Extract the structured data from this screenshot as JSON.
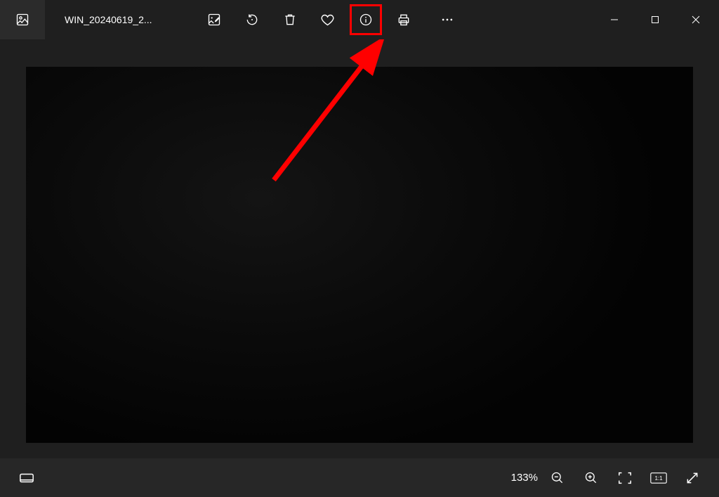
{
  "title": "WIN_20240619_2...",
  "toolbar": {
    "edit": "edit-image",
    "rotate": "rotate",
    "delete": "delete",
    "favorite": "favorite",
    "info": "file-info",
    "print": "print",
    "more": "more"
  },
  "window": {
    "minimize": "minimize",
    "maximize": "maximize",
    "close": "close"
  },
  "bottom": {
    "filmstrip": "filmstrip",
    "zoom_label": "133%",
    "zoom_out": "zoom-out",
    "zoom_in": "zoom-in",
    "fit": "zoom-to-fit",
    "actual": "actual-size",
    "fullscreen": "fullscreen"
  },
  "annotation": {
    "target": "file-info-button",
    "color": "#ff0000"
  }
}
